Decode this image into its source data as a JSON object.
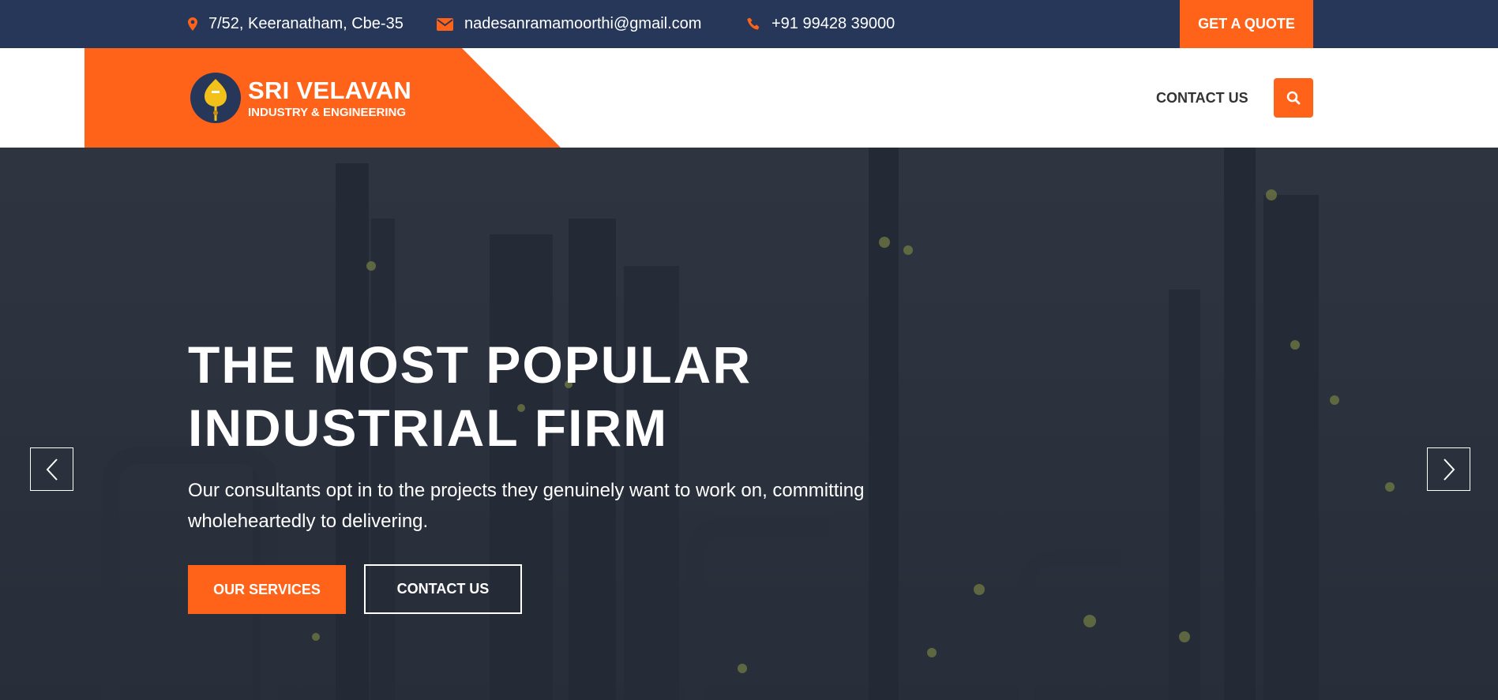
{
  "topbar": {
    "address": "7/52, Keeranatham, Cbe-35",
    "email": "nadesanramamoorthi@gmail.com",
    "phone": "+91 99428 39000",
    "quote_label": "GET A QUOTE",
    "icons": [
      "map-marker-icon",
      "envelope-icon",
      "phone-icon"
    ]
  },
  "header": {
    "logo_title": "SRI VELAVAN",
    "logo_subtitle": "INDUSTRY & ENGINEERING",
    "nav_contact": "CONTACT US",
    "search_icon": "search-icon"
  },
  "hero": {
    "title_line1": "THE MOST POPULAR",
    "title_line2": "INDUSTRIAL FIRM",
    "text": "Our consultants opt in to the projects they genuinely want to work on, committing wholeheartedly to delivering.",
    "primary_button": "OUR SERVICES",
    "secondary_button": "CONTACT US",
    "prev_icon": "chevron-left-icon",
    "next_icon": "chevron-right-icon"
  },
  "colors": {
    "navy": "#263759",
    "accent": "#ff6319",
    "white": "#ffffff",
    "nav_text": "#333333"
  }
}
